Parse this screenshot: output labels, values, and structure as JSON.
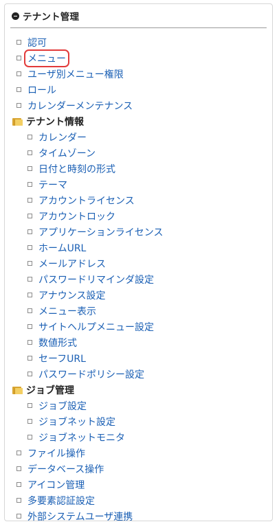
{
  "panel": {
    "title": "テナント管理"
  },
  "tree": {
    "top": [
      {
        "label": "認可"
      },
      {
        "label": "メニュー",
        "selected": true
      },
      {
        "label": "ユーザ別メニュー権限"
      },
      {
        "label": "ロール"
      },
      {
        "label": "カレンダーメンテナンス"
      }
    ],
    "tenant_info": {
      "label": "テナント情報",
      "items": [
        {
          "label": "カレンダー"
        },
        {
          "label": "タイムゾーン"
        },
        {
          "label": "日付と時刻の形式"
        },
        {
          "label": "テーマ"
        },
        {
          "label": "アカウントライセンス"
        },
        {
          "label": "アカウントロック"
        },
        {
          "label": "アプリケーションライセンス"
        },
        {
          "label": "ホームURL"
        },
        {
          "label": "メールアドレス"
        },
        {
          "label": "パスワードリマインダ設定"
        },
        {
          "label": "アナウンス設定"
        },
        {
          "label": "メニュー表示"
        },
        {
          "label": "サイトヘルプメニュー設定"
        },
        {
          "label": "数値形式"
        },
        {
          "label": "セーフURL"
        },
        {
          "label": "パスワードポリシー設定"
        }
      ]
    },
    "job_management": {
      "label": "ジョブ管理",
      "items": [
        {
          "label": "ジョブ設定"
        },
        {
          "label": "ジョブネット設定"
        },
        {
          "label": "ジョブネットモニタ"
        }
      ]
    },
    "bottom": [
      {
        "label": "ファイル操作"
      },
      {
        "label": "データベース操作"
      },
      {
        "label": "アイコン管理"
      },
      {
        "label": "多要素認証設定"
      },
      {
        "label": "外部システムユーザ連携"
      }
    ]
  },
  "colors": {
    "link": "#1a5fb4",
    "selection_outline": "#e23a3a",
    "folder": "#f3cf63"
  }
}
